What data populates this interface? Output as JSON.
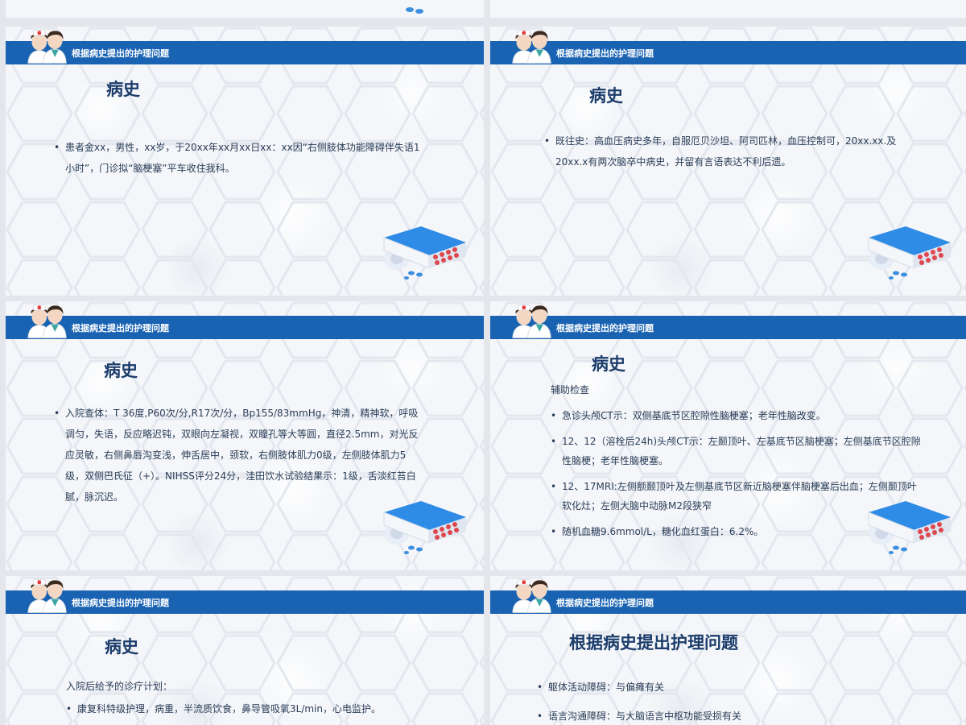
{
  "header_label": "根据病史提出的护理问题",
  "slides": [
    {
      "title": "病史",
      "paragraphs": [
        "患者金xx，男性，xx岁，于20xx年xx月xx日xx：xx因“右侧肢体功能障碍伴失语1小时”，门诊拟“脑梗塞”平车收住我科。"
      ]
    },
    {
      "title": "病史",
      "paragraphs": [
        "既往史：高血压病史多年，自服厄贝沙坦、阿司匹林，血压控制可，20xx.xx.及20xx.x有两次脑卒中病史，并留有言语表达不利后遗。"
      ]
    },
    {
      "title": "病史",
      "paragraphs": [
        "入院查体：T 36度,P60次/分,R17次/分，Bp155/83mmHg，神清，精神软，呼吸调匀，失语，反应略迟钝，双眼向左凝视，双瞳孔等大等圆，直径2.5mm，对光反应灵敏，右侧鼻唇沟变浅，伸舌居中，颈软，右侧肢体肌力0级，左侧肢体肌力5级，双侧巴氏征（+）。NIHSS评分24分，洼田饮水试验结果示：1级，舌淡红苔白腻，脉沉迟。"
      ]
    },
    {
      "title": "病史",
      "intro": "辅助检查",
      "paragraphs": [
        "急诊头颅CT示：双侧基底节区腔隙性脑梗塞；老年性脑改变。",
        "12、12（溶栓后24h)头颅CT示：左颞顶叶、左基底节区脑梗塞；左侧基底节区腔隙性脑梗；老年性脑梗塞。",
        "12、17MRI:左侧额颞顶叶及左侧基底节区新近脑梗塞伴脑梗塞后出血；左侧颞顶叶软化灶；左侧大脑中动脉M2段狭窄",
        "随机血糖9.6mmol/L，糖化血红蛋白：6.2%。"
      ]
    },
    {
      "title": "病史",
      "intro": "入院后给予的诊疗计划：",
      "paragraphs": [
        "康复科特级护理，病重，半流质饮食，鼻导管吸氧3L/min，心电监护。"
      ]
    },
    {
      "title": "根据病史提出护理问题",
      "paragraphs": [
        "躯体活动障碍：与偏瘫有关",
        "语言沟通障碍：与大脑语言中枢功能受损有关"
      ]
    }
  ]
}
